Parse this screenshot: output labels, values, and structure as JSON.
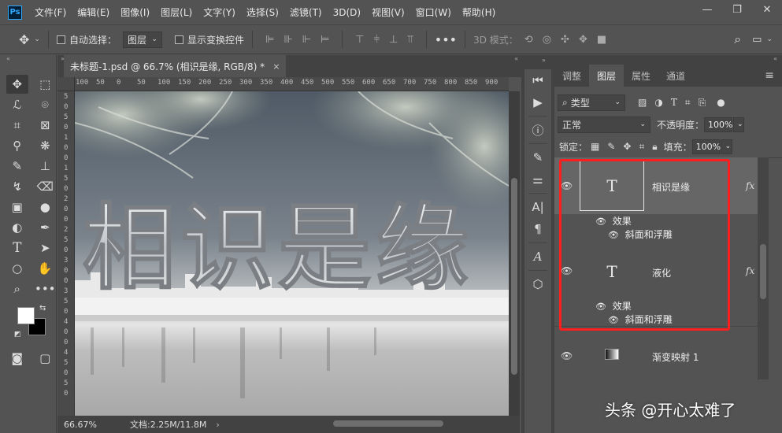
{
  "app": {
    "logo_text": "Ps"
  },
  "menu": [
    "文件(F)",
    "编辑(E)",
    "图像(I)",
    "图层(L)",
    "文字(Y)",
    "选择(S)",
    "滤镜(T)",
    "3D(D)",
    "视图(V)",
    "窗口(W)",
    "帮助(H)"
  ],
  "window_controls": {
    "minimize": "—",
    "restore": "❐",
    "close": "✕"
  },
  "options_bar": {
    "auto_select_label": "自动选择：",
    "auto_select_target": "图层",
    "show_transform_label": "显示变换控件",
    "mode_3d_label": "3D 模式："
  },
  "document": {
    "tab_title": "未标题-1.psd @ 66.7% (相识是缘, RGB/8) *",
    "tab_close": "×",
    "ruler_h": [
      "100",
      "50",
      "0",
      "50",
      "100",
      "150",
      "200",
      "250",
      "300",
      "350",
      "400",
      "450",
      "500",
      "550",
      "600",
      "650",
      "700",
      "750",
      "800",
      "850",
      "900"
    ],
    "ruler_v": [
      "5",
      "0",
      "5",
      "0",
      "1",
      "0",
      "0",
      "1",
      "5",
      "0",
      "2",
      "0",
      "0",
      "2",
      "5",
      "0",
      "3",
      "0",
      "0",
      "3",
      "5",
      "0",
      "4",
      "0",
      "0",
      "4",
      "5",
      "0",
      "5",
      "0"
    ],
    "canvas_text": "相识是缘"
  },
  "status": {
    "zoom": "66.67%",
    "doc_info": "文档:2.25M/11.8M",
    "arrow": "›"
  },
  "panel": {
    "tabs": [
      "调整",
      "图层",
      "属性",
      "通道"
    ],
    "active_tab": "图层",
    "filter_kind": "类型",
    "blend_mode": "正常",
    "opacity_label": "不透明度：",
    "opacity_value": "100%",
    "lock_label": "锁定：",
    "fill_label": "填充：",
    "fill_value": "100%"
  },
  "layers": [
    {
      "name": "相识是缘",
      "type": "text",
      "thumb": "T",
      "fx": "fx",
      "effects_label": "效果",
      "effect": "斜面和浮雕",
      "selected": true
    },
    {
      "name": "液化",
      "type": "text",
      "thumb": "T",
      "fx": "fx",
      "effects_label": "效果",
      "effect": "斜面和浮雕",
      "selected": false
    },
    {
      "name": "渐变映射 1",
      "type": "adjustment",
      "thumb": "",
      "selected": false
    },
    {
      "name": "",
      "type": "image",
      "thumb": "",
      "selected": false
    }
  ],
  "watermark": "头条 @开心太难了",
  "colors": {
    "highlight": "#ff1e1e",
    "ui_bg": "#535353",
    "panel_dark": "#424242"
  }
}
